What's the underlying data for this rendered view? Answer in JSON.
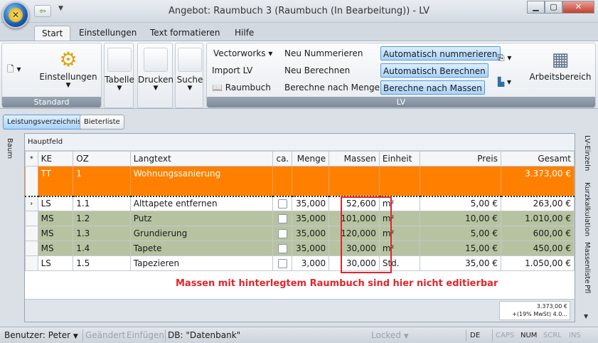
{
  "window": {
    "title": "Angebot: Raumbuch 3  (Raumbuch  (In Bearbeitung)) - LV",
    "controls": [
      "minimize",
      "maximize",
      "close"
    ]
  },
  "ribbon_tabs": [
    "Start",
    "Einstellungen",
    "Text formatieren",
    "Hilfe"
  ],
  "ribbon": {
    "standard": {
      "label": "Standard",
      "einstellungen": "Einstellungen"
    },
    "tabelle": "Tabelle",
    "drucken": "Drucken",
    "suche": "Suche",
    "lv": {
      "label": "LV",
      "vectorworks": "Vectorworks",
      "import_lv": "Import LV",
      "raumbuch": "Raumbuch",
      "neu_nummerieren": "Neu Nummerieren",
      "neu_berechnen": "Neu Berechnen",
      "berechne_menge": "Berechne nach Menge",
      "auto_nummerieren": "Automatisch nummerieren",
      "auto_berechnen": "Automatisch Berechnen",
      "berechne_massen": "Berechne nach Massen"
    },
    "arbeitsbereich": "Arbeitsbereich"
  },
  "doc_tabs": [
    "Leistungsverzeichnis",
    "Bieterliste"
  ],
  "left_sidebar": [
    "Baum"
  ],
  "right_sidebar": [
    "LV-Einzeln",
    "Kurzkalkulation",
    "Massenliste",
    "Pfl"
  ],
  "grid": {
    "header": "Hauptfeld",
    "columns": [
      "*",
      "KE",
      "OZ",
      "Langtext",
      "ca.",
      "Menge",
      "Massen",
      "Einheit",
      "Preis",
      "Gesamt"
    ],
    "rows": [
      {
        "ke": "TT",
        "oz": "1",
        "langtext": "Wohnungssanierung",
        "ca": "",
        "menge": "",
        "massen": "",
        "einheit": "",
        "preis": "",
        "gesamt": "3.373,00 €"
      },
      {
        "ke": "LS",
        "oz": "1.1",
        "langtext": "Alttapete entfernen",
        "ca": "box",
        "menge": "35,000",
        "massen": "52,600",
        "einheit": "m²",
        "preis": "5,00 €",
        "gesamt": "263,00 €"
      },
      {
        "ke": "MS",
        "oz": "1.2",
        "langtext": "Putz",
        "ca": "box",
        "menge": "35,000",
        "massen": "101,000",
        "einheit": "m²",
        "preis": "10,00 €",
        "gesamt": "1.010,00 €"
      },
      {
        "ke": "MS",
        "oz": "1.3",
        "langtext": "Grundierung",
        "ca": "box",
        "menge": "35,000",
        "massen": "120,000",
        "einheit": "m²",
        "preis": "5,00 €",
        "gesamt": "600,00 €"
      },
      {
        "ke": "MS",
        "oz": "1.4",
        "langtext": "Tapete",
        "ca": "box",
        "menge": "35,000",
        "massen": "30,000",
        "einheit": "m²",
        "preis": "15,00 €",
        "gesamt": "450,00 €"
      },
      {
        "ke": "LS",
        "oz": "1.5",
        "langtext": "Tapezieren",
        "ca": "box",
        "menge": "3,000",
        "massen": "30,000",
        "einheit": "Std.",
        "preis": "35,00 €",
        "gesamt": "1.050,00 €"
      }
    ],
    "notice": "Massen mit hinterlegtem Raumbuch sind hier nicht editierbar",
    "total_line1": "3.373,00 €",
    "total_line2": "+(19% MwSt) 4.0..."
  },
  "statusbar": {
    "benutzer": "Benutzer: Peter",
    "geaendert": "Geändert",
    "einfuegen": "Einfügen",
    "db": "DB: \"Datenbank\"",
    "locked": "Locked",
    "lang": "DE",
    "caps": "CAPS",
    "num": "NUM",
    "scrl": "SCRL",
    "ins": "INS"
  },
  "colors": {
    "orange_row": "#ff8000",
    "green_row": "#b7c3a0",
    "notice_red": "#e0262b",
    "highlight_blue": "#a9d3fb"
  }
}
